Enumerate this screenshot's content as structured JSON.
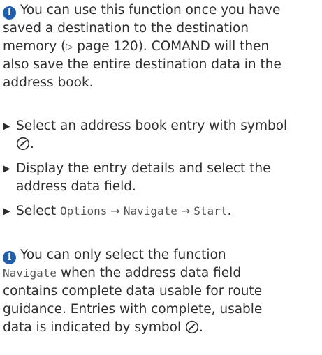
{
  "info_note_1": {
    "lines": [
      "You can use this function once you have",
      "saved a destination to the destination",
      "memory (",
      "page 120). COMAND will then",
      "also save the entire destination data in the",
      "address book."
    ],
    "ref_symbol": "▷"
  },
  "steps": [
    {
      "bullet": "▶",
      "lines": [
        "Select an address book entry with symbol",
        "."
      ]
    },
    {
      "bullet": "▶",
      "lines": [
        "Display the entry details and select the",
        "address data field."
      ]
    },
    {
      "bullet": "▶",
      "prefix": "Select",
      "options": "Options",
      "navigate": "Navigate",
      "start": "Start",
      "suffix": ".",
      "arrow": "→"
    }
  ],
  "info_note_2": {
    "line1": "You can only select the function",
    "navigate_term": "Navigate",
    "line2_rest": " when the address data field",
    "line3": "contains complete data usable for route",
    "line4": "guidance. Entries with complete, usable",
    "line5": "data is indicated by symbol",
    "line5_end": "."
  },
  "icons": {
    "info": "info-icon",
    "navigation_symbol": "navigation-compass-icon",
    "info_glyph": "i"
  },
  "colors": {
    "info_icon": "#1f5fae",
    "text": "#2e2e2e",
    "mono_text": "#555555"
  }
}
